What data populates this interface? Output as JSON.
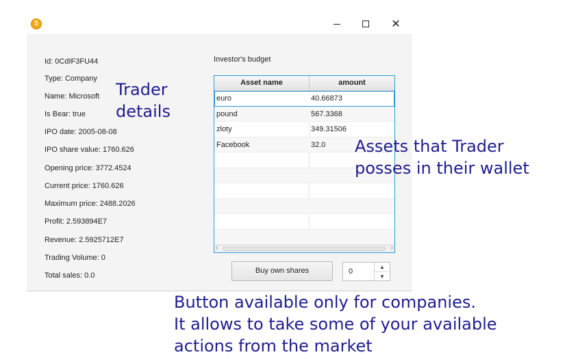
{
  "window": {
    "icon": "coin-icon",
    "controls": [
      "minimize-icon",
      "maximize-icon",
      "close-icon"
    ]
  },
  "details": {
    "id": "Id: 0CdIF3FU44",
    "type": "Type: Company",
    "name": "Name: Microsoft",
    "bear": "Is Bear: true",
    "ipo_date": "IPO date: 2005-08-08",
    "ipo_share_value": "IPO share value: 1760.626",
    "opening_price": "Opening price: 3772.4524",
    "current_price": "Current price: 1760.626",
    "maximum_price": "Maximum price: 2488.2026",
    "profit": "Profit: 2.593894E7",
    "revenue": "Revenue: 2.5925712E7",
    "trading_volume": "Trading Volume: 0",
    "total_sales": "Total sales: 0.0"
  },
  "budget": {
    "label": "Investor's budget",
    "headers": [
      "Asset name",
      "amount"
    ],
    "rows": [
      {
        "asset": "euro",
        "amount": "40.66873"
      },
      {
        "asset": "pound",
        "amount": "567.3368"
      },
      {
        "asset": "zloty",
        "amount": "349.31506"
      },
      {
        "asset": "Facebook",
        "amount": "32.0"
      }
    ]
  },
  "actions": {
    "buy_button": "Buy own shares",
    "quantity": "0"
  },
  "annotations": {
    "trader": "Trader\ndetails",
    "assets": "Assets that Trader\nposses in their wallet",
    "button": "Button available only for companies.\nIt allows to take some of your available\nactions from the market"
  },
  "colors": {
    "annotation": "#1f1d8f",
    "selection_border": "#2b9ad8"
  }
}
